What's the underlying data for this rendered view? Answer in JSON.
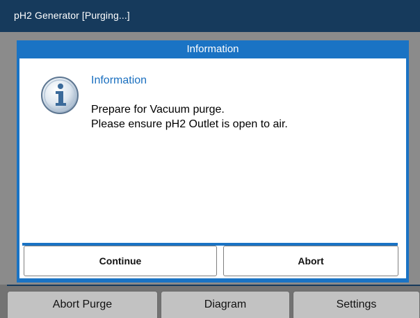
{
  "window": {
    "title": "pH2 Generator  [Purging...]"
  },
  "dialog": {
    "header": "Information",
    "heading": "Information",
    "icon": "info-icon",
    "message_lines": [
      "Prepare for Vacuum purge.",
      "Please ensure pH2 Outlet is open to air."
    ],
    "buttons": {
      "continue": "Continue",
      "abort": "Abort"
    }
  },
  "tabs": [
    {
      "label": "Abort Purge"
    },
    {
      "label": "Diagram"
    },
    {
      "label": "Settings"
    }
  ],
  "colors": {
    "titlebar": "#163a5c",
    "accent": "#1a73c4",
    "workspace": "#8b8b8b",
    "tab": "#c2c2c2"
  }
}
